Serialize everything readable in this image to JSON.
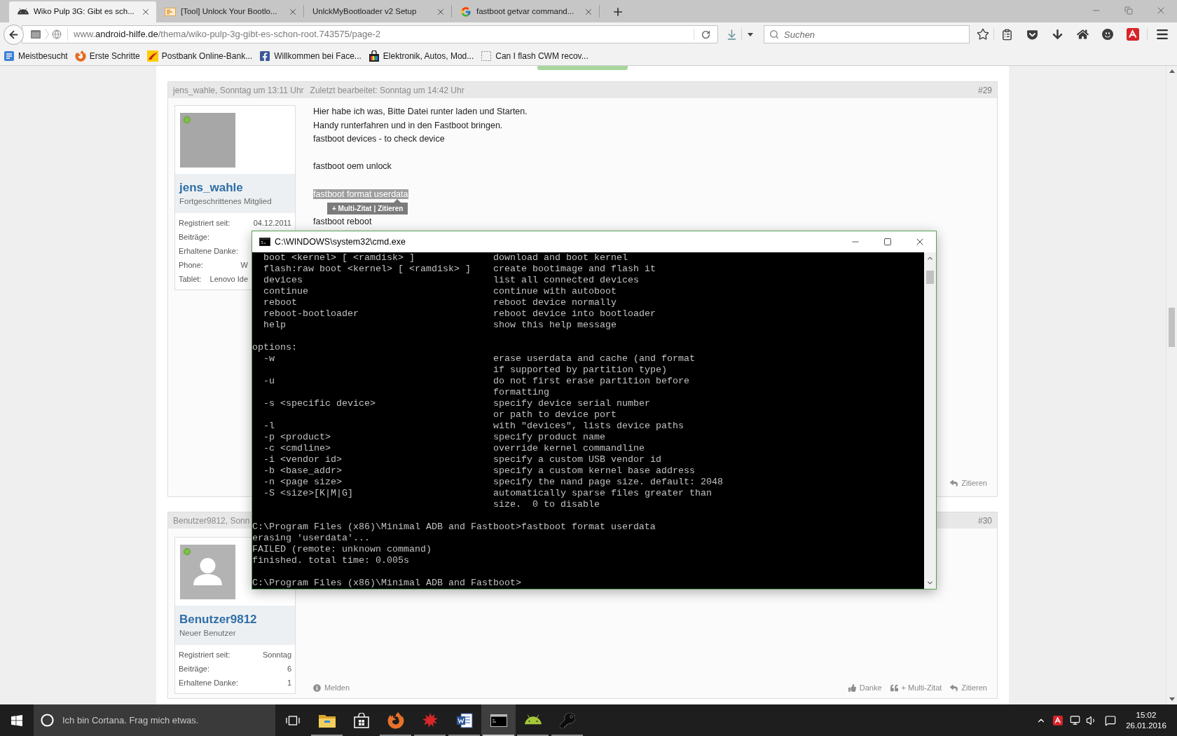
{
  "browser": {
    "tabs": [
      {
        "kind": "forum",
        "title": "Wiko Pulp 3G: Gibt es sch...",
        "selected": true
      },
      {
        "kind": "download",
        "title": "[Tool] Unlock Your Bootlo...",
        "selected": false
      },
      {
        "kind": "page",
        "title": "UnlckMyBootloader v2 Setup",
        "selected": false
      },
      {
        "kind": "search",
        "title": "fastboot getvar command...",
        "selected": false
      }
    ],
    "address": {
      "prefix": "www.",
      "domain": "android-hilfe.de",
      "path": "/thema/wiko-pulp-3g-gibt-es-schon-root.743575/page-2"
    },
    "search": {
      "placeholder": "Suchen"
    },
    "bookmarks": [
      {
        "kind": "folder",
        "label": "Meistbesucht"
      },
      {
        "kind": "browser",
        "label": "Erste Schritte"
      },
      {
        "kind": "bank",
        "label": "Postbank Online-Bank..."
      },
      {
        "kind": "social",
        "label": "Willkommen bei Face..."
      },
      {
        "kind": "shop",
        "label": "Elektronik, Autos, Mod..."
      },
      {
        "kind": "blank",
        "label": "Can I flash CWM recov..."
      }
    ]
  },
  "thread": {
    "posts": [
      {
        "author_line": "jens_wahle, Sonntag um 13:11 Uhr",
        "edited": "Zuletzt bearbeitet: Sonntag um 14:42 Uhr",
        "number": "#29",
        "user": {
          "name": "jens_wahle",
          "rank": "Fortgeschrittenes Mitglied",
          "online": true,
          "avatar": {
            "kind": "photo"
          }
        },
        "stats": [
          {
            "label": "Registriert seit:",
            "value": "04.12.2011"
          },
          {
            "label": "Beiträge:"
          },
          {
            "label": "Erhaltene Danke:"
          },
          {
            "label": "Phone:",
            "value": "W"
          },
          {
            "label": "Tablet:",
            "value": "Lenovo Ide"
          }
        ],
        "paragraphs": [
          {
            "lines": [
              "Hier habe ich was, Bitte Datei runter laden und Starten.",
              "Handy runterfahren und in den Fastboot bringen.",
              "fastboot devices - to check device"
            ],
            "highlighted": false
          },
          {
            "lines": [
              "fastboot oem unlock"
            ],
            "highlighted": false
          },
          {
            "lines": [
              "fastboot format userdata"
            ],
            "highlighted": true
          },
          {
            "lines": [
              "fastboot reboot"
            ],
            "highlighted": false
          }
        ],
        "quote_popup": {
          "links": [
            "+ Multi-Zitat",
            "Zitieren"
          ],
          "separator": "|"
        },
        "actions": [
          {
            "kind": "reply",
            "label": "Zitieren"
          }
        ]
      },
      {
        "author_line": "Benutzer9812, Sonn",
        "number": "#30",
        "user": {
          "name": "Benutzer9812",
          "rank": "Neuer Benutzer",
          "online": true,
          "avatar": {
            "kind": "default"
          }
        },
        "stats": [
          {
            "label": "Registriert seit:",
            "value": "Sonntag"
          },
          {
            "label": "Beiträge:",
            "value": "6"
          },
          {
            "label": "Erhaltene Danke:",
            "value": "1"
          }
        ],
        "actions": [
          {
            "kind": "report",
            "label": "Melden"
          },
          {
            "kind": "like",
            "label": "Danke"
          },
          {
            "kind": "multiquote",
            "label": "+ Multi-Zitat"
          },
          {
            "kind": "reply",
            "label": "Zitieren"
          }
        ]
      }
    ]
  },
  "console_window": {
    "title": "C:\\WINDOWS\\system32\\cmd.exe",
    "lines": [
      {
        "kind": "entry",
        "command": "boot <kernel> [ <ramdisk> ]",
        "description": "download and boot kernel"
      },
      {
        "kind": "entry",
        "command": "flash:raw boot <kernel> [ <ramdisk> ]",
        "description": "create bootimage and flash it"
      },
      {
        "kind": "entry",
        "command": "devices",
        "description": "list all connected devices"
      },
      {
        "kind": "entry",
        "command": "continue",
        "description": "continue with autoboot"
      },
      {
        "kind": "entry",
        "command": "reboot",
        "description": "reboot device normally"
      },
      {
        "kind": "entry",
        "command": "reboot-bootloader",
        "description": "reboot device into bootloader"
      },
      {
        "kind": "entry",
        "command": "help",
        "description": "show this help message"
      },
      {
        "kind": "blank"
      },
      {
        "kind": "line",
        "text": "options:"
      },
      {
        "kind": "entry",
        "command": "-w",
        "description": "erase userdata and cache (and format"
      },
      {
        "kind": "entry",
        "description": "if supported by partition type)"
      },
      {
        "kind": "entry",
        "command": "-u",
        "description": "do not first erase partition before"
      },
      {
        "kind": "entry",
        "description": "formatting"
      },
      {
        "kind": "entry",
        "command": "-s <specific device>",
        "description": "specify device serial number"
      },
      {
        "kind": "entry",
        "description": "or path to device port"
      },
      {
        "kind": "entry",
        "command": "-l",
        "description": "with \"devices\", lists device paths"
      },
      {
        "kind": "entry",
        "command": "-p <product>",
        "description": "specify product name"
      },
      {
        "kind": "entry",
        "command": "-c <cmdline>",
        "description": "override kernel commandline"
      },
      {
        "kind": "entry",
        "command": "-i <vendor id>",
        "description": "specify a custom USB vendor id"
      },
      {
        "kind": "entry",
        "command": "-b <base_addr>",
        "description": "specify a custom kernel base address"
      },
      {
        "kind": "entry",
        "command": "-n <page size>",
        "description": "specify the nand page size. default: 2048"
      },
      {
        "kind": "entry",
        "command": "-S <size>[K|M|G]",
        "description": "automatically sparse files greater than"
      },
      {
        "kind": "entry",
        "description": "size.  0 to disable"
      },
      {
        "kind": "blank"
      },
      {
        "kind": "line",
        "text": "C:\\Program Files (x86)\\Minimal ADB and Fastboot>fastboot format userdata"
      },
      {
        "kind": "line",
        "text": "erasing 'userdata'..."
      },
      {
        "kind": "line",
        "text": "FAILED (remote: unknown command)"
      },
      {
        "kind": "line",
        "text": "finished. total time: 0.005s"
      },
      {
        "kind": "blank"
      },
      {
        "kind": "line",
        "text": "C:\\Program Files (x86)\\Minimal ADB and Fastboot>"
      }
    ]
  },
  "taskbar": {
    "search": {
      "placeholder": "Ich bin Cortana. Frag mich etwas."
    },
    "apps": [
      {
        "kind": "files",
        "running": true,
        "active": false
      },
      {
        "kind": "store",
        "running": false,
        "active": false
      },
      {
        "kind": "browser",
        "running": true,
        "active": false
      },
      {
        "kind": "game",
        "running": true,
        "active": false
      },
      {
        "kind": "writer",
        "running": true,
        "active": false
      },
      {
        "kind": "console",
        "running": true,
        "active": true
      },
      {
        "kind": "android",
        "running": true,
        "active": false
      },
      {
        "kind": "tool",
        "running": true,
        "active": false
      }
    ],
    "clock": {
      "time": "15:02",
      "date": "26.01.2016"
    }
  }
}
